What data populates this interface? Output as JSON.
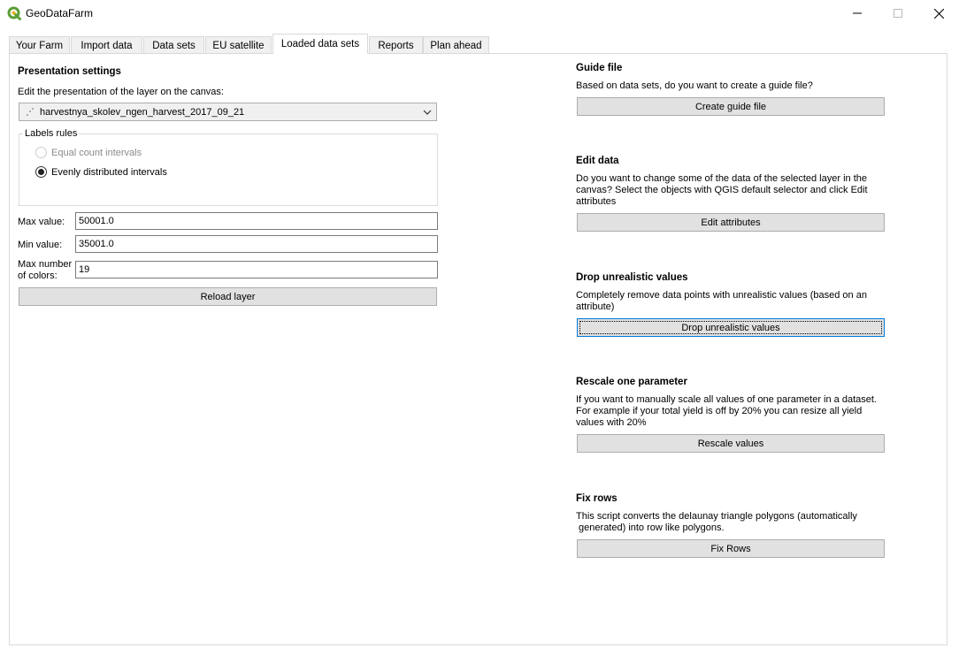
{
  "window": {
    "title": "GeoDataFarm",
    "icon": "qgis-logo-icon",
    "accent": "#5a9e36"
  },
  "tabs": [
    {
      "label": "Your Farm"
    },
    {
      "label": "Import data"
    },
    {
      "label": "Data sets"
    },
    {
      "label": "EU satellite"
    },
    {
      "label": "Loaded data sets",
      "active": true
    },
    {
      "label": "Reports"
    },
    {
      "label": "Plan ahead"
    }
  ],
  "left": {
    "heading": "Presentation settings",
    "edit_label": "Edit the presentation of the layer on the canvas:",
    "layer_select": "harvestnya_skolev_ngen_harvest_2017_09_21",
    "labels_rules": {
      "legend": "Labels rules",
      "option_equal": "Equal count intervals",
      "option_even": "Evenly distributed intervals",
      "selected": "Evenly distributed intervals"
    },
    "max_value_label": "Max value:",
    "max_value": "50001.0",
    "min_value_label": "Min value:",
    "min_value": "35001.0",
    "max_colors_label_1": "Max number",
    "max_colors_label_2": "of colors:",
    "max_colors": "19",
    "reload_button": "Reload layer"
  },
  "right": {
    "guide": {
      "heading": "Guide file",
      "desc": "Based on data sets, do you want to create a guide file?",
      "button": "Create guide file"
    },
    "edit": {
      "heading": "Edit data",
      "desc_1": "Do you want to change some of the data of the selected layer in the",
      "desc_2": "canvas? Select the objects with QGIS default selector and click Edit",
      "desc_3": "attributes",
      "button": "Edit attributes"
    },
    "drop": {
      "heading": "Drop unrealistic values",
      "desc_1": "Completely remove data points with unrealistic values (based on an",
      "desc_2": "attribute)",
      "button": "Drop unrealistic values"
    },
    "rescale": {
      "heading": "Rescale one parameter",
      "desc_1": "If you want to manually scale all values of one parameter in a dataset.",
      "desc_2": "For example if your total yield is off by 20% you can resize all yield",
      "desc_3": "values with 20%",
      "button": "Rescale values"
    },
    "fix": {
      "heading": "Fix rows",
      "desc_1": "This script converts the delaunay triangle polygons (automatically",
      "desc_2": " generated) into row like polygons.",
      "button": "Fix Rows"
    }
  }
}
